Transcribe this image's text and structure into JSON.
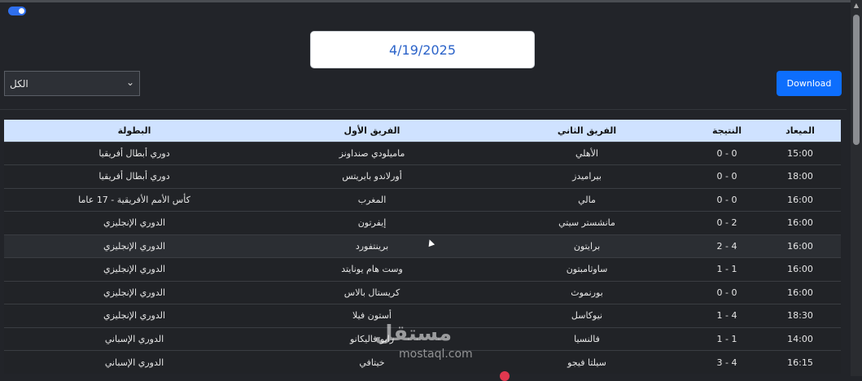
{
  "date": "4/19/2025",
  "filter": {
    "selected": "الكل"
  },
  "download_label": "Download",
  "table": {
    "headers": {
      "time": "الميعاد",
      "score": "النتيجة",
      "team2": "الفريق الثاني",
      "team1": "الفريق الأول",
      "league": "البطولة"
    },
    "rows": [
      {
        "time": "15:00",
        "score": "0 - 0",
        "team2": "الأهلي",
        "team1": "ماميلودي صنداونز",
        "league": "دوري أبطال أفريقيا"
      },
      {
        "time": "18:00",
        "score": "0 - 0",
        "team2": "بيراميدز",
        "team1": "أورلاندو بايريتس",
        "league": "دوري أبطال أفريقيا"
      },
      {
        "time": "16:00",
        "score": "0 - 0",
        "team2": "مالي",
        "team1": "المغرب",
        "league": "كأس الأمم الأفريقية - 17 عاما"
      },
      {
        "time": "16:00",
        "score": "0 - 2",
        "team2": "مانشستر سيتي",
        "team1": "إيفرتون",
        "league": "الدوري الإنجليزي"
      },
      {
        "time": "16:00",
        "score": "2 - 4",
        "team2": "برايتون",
        "team1": "برينتفورد",
        "league": "الدوري الإنجليزي"
      },
      {
        "time": "16:00",
        "score": "1 - 1",
        "team2": "ساوثامبتون",
        "team1": "وست هام يونايتد",
        "league": "الدوري الإنجليزي"
      },
      {
        "time": "16:00",
        "score": "0 - 0",
        "team2": "بورنموث",
        "team1": "كريستال بالاس",
        "league": "الدوري الإنجليزي"
      },
      {
        "time": "18:30",
        "score": "1 - 4",
        "team2": "نيوكاسل",
        "team1": "أستون فيلا",
        "league": "الدوري الإنجليزي"
      },
      {
        "time": "14:00",
        "score": "1 - 1",
        "team2": "فالنسيا",
        "team1": "رايو فاليكانو",
        "league": "الدوري الإسباني"
      },
      {
        "time": "16:15",
        "score": "3 - 4",
        "team2": "سيلتا فيجو",
        "team1": "خيتافي",
        "league": "الدوري الإسباني"
      }
    ]
  },
  "watermark": {
    "text": "مستقل",
    "sub": "mostaql.com"
  },
  "colors": {
    "accent": "#0d6efd",
    "header_bg": "#cfe2ff",
    "page_bg": "#222429"
  }
}
